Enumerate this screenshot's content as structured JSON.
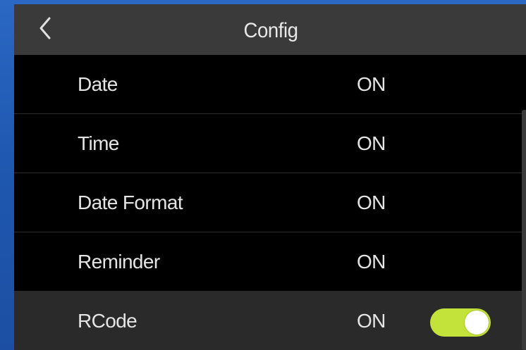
{
  "header": {
    "title": "Config",
    "back_icon": "chevron-left-icon"
  },
  "settings": [
    {
      "label": "Date",
      "value": "ON"
    },
    {
      "label": "Time",
      "value": "ON"
    },
    {
      "label": "Date Format",
      "value": "ON"
    },
    {
      "label": "Reminder",
      "value": "ON"
    },
    {
      "label": "RCode",
      "value": "ON",
      "toggle": true
    }
  ],
  "colors": {
    "background": "#1f5fb8",
    "header": "#3a3a3a",
    "list_background": "#000000",
    "selected_row": "#2a2a2a",
    "toggle_on": "#c3e23a",
    "text": "#e4e4e4"
  }
}
